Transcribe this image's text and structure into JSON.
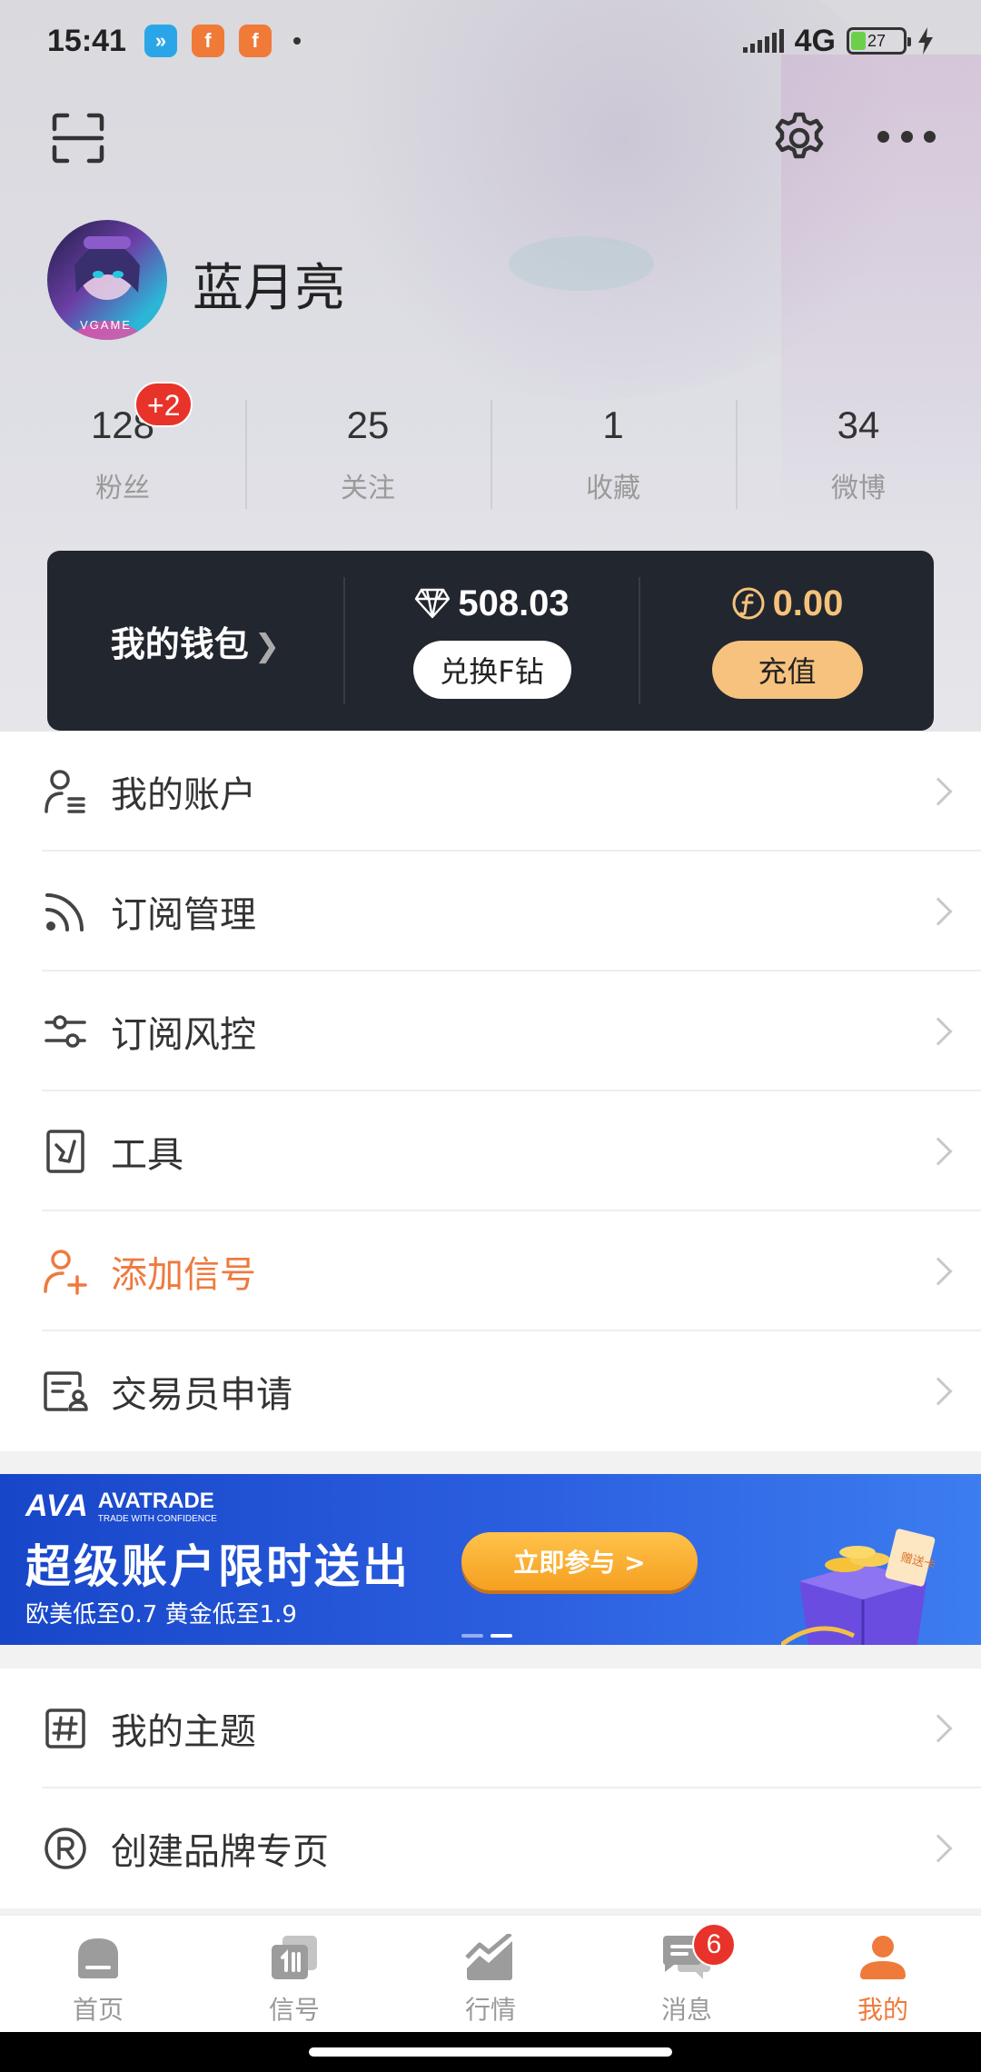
{
  "status_bar": {
    "time": "15:41",
    "network": "4G",
    "battery": "27",
    "notification_icons": [
      "browser-icon",
      "app-f-icon",
      "app-f-icon"
    ]
  },
  "header": {
    "icons": [
      "scan-icon",
      "gear-icon",
      "more-icon"
    ]
  },
  "profile": {
    "name": "蓝月亮",
    "avatar_text": "VGAME"
  },
  "stats": [
    {
      "value": "128",
      "label": "粉丝",
      "badge": "+2"
    },
    {
      "value": "25",
      "label": "关注"
    },
    {
      "value": "1",
      "label": "收藏"
    },
    {
      "value": "34",
      "label": "微博"
    }
  ],
  "wallet": {
    "title": "我的钱包",
    "diamond_amount": "508.03",
    "exchange_button": "兑换F钻",
    "coin_amount": "0.00",
    "recharge_button": "充值",
    "accent_color": "#f6c27e"
  },
  "menu_top": [
    {
      "label": "我的账户",
      "icon": "user-account-icon"
    },
    {
      "label": "订阅管理",
      "icon": "rss-icon"
    },
    {
      "label": "订阅风控",
      "icon": "sliders-icon"
    },
    {
      "label": "工具",
      "icon": "tool-icon"
    },
    {
      "label": "添加信号",
      "icon": "add-user-icon",
      "highlight": true
    },
    {
      "label": "交易员申请",
      "icon": "trader-apply-icon"
    }
  ],
  "banner": {
    "logo": "AVA",
    "brand": "AVATRADE",
    "tagline": "TRADE WITH CONFIDENCE",
    "title": "超级账户限时送出",
    "subtitle": "欧美低至0.7 黄金低至1.9",
    "cta": "立即参与 >",
    "gift_text": "赠送卡"
  },
  "menu_bottom": [
    {
      "label": "我的主题",
      "icon": "hashtag-icon"
    },
    {
      "label": "创建品牌专页",
      "icon": "registered-icon"
    }
  ],
  "tabs": [
    {
      "label": "首页",
      "icon": "home-icon"
    },
    {
      "label": "信号",
      "icon": "signal-icon"
    },
    {
      "label": "行情",
      "icon": "chart-icon"
    },
    {
      "label": "消息",
      "icon": "message-icon",
      "badge": "6"
    },
    {
      "label": "我的",
      "icon": "profile-icon",
      "active": true
    }
  ],
  "colors": {
    "accent_orange": "#ef7a3a",
    "badge_red": "#e8332a",
    "wallet_bg": "#22262f"
  }
}
